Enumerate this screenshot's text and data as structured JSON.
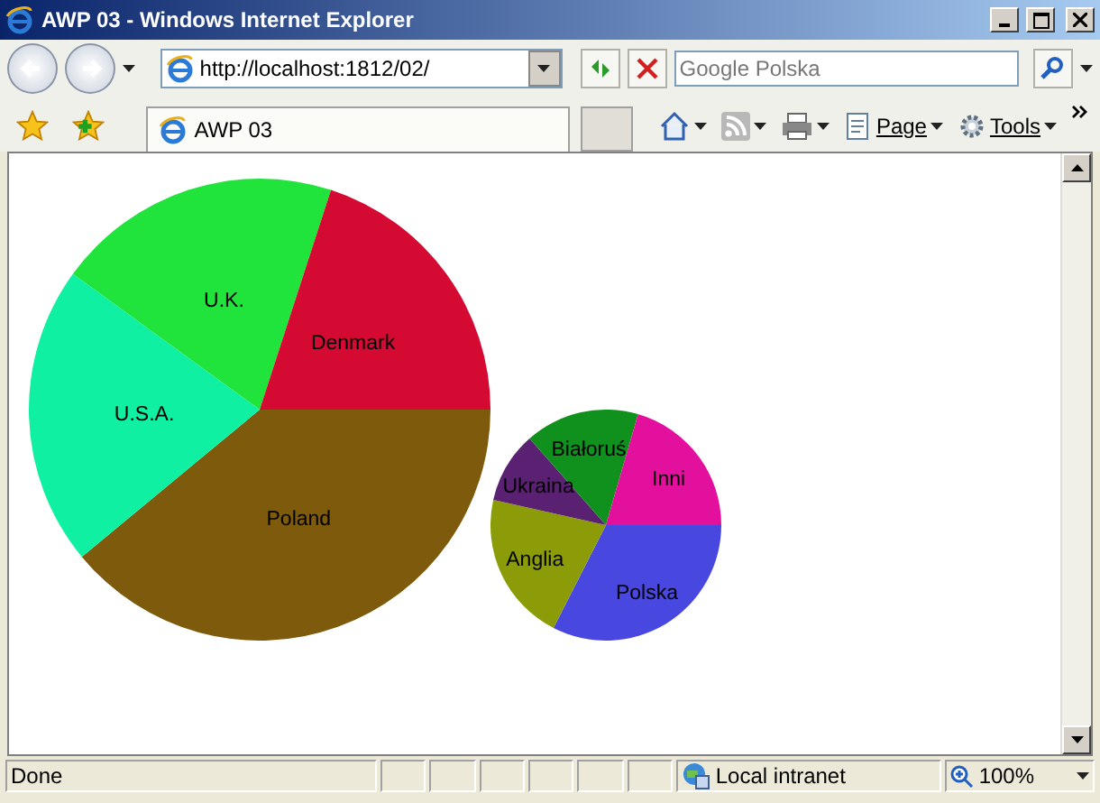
{
  "window": {
    "title": "AWP 03 - Windows Internet Explorer"
  },
  "address_bar": {
    "value": "http://localhost:1812/02/"
  },
  "search": {
    "placeholder": "Google Polska"
  },
  "tab": {
    "label": "AWP 03",
    "selected": true
  },
  "command_bar": [
    {
      "label": "Page"
    },
    {
      "label": "Tools"
    }
  ],
  "charts": [
    {
      "chart_data": {
        "type": "pie",
        "categories": [
          "Poland",
          "U.S.A.",
          "U.K.",
          "Denmark"
        ],
        "values": [
          39,
          21,
          20,
          20
        ],
        "colors": [
          "#7e5a0c",
          "#10f0a2",
          "#20e33c",
          "#d40a32"
        ]
      }
    },
    {
      "chart_data": {
        "type": "pie",
        "categories": [
          "Polska",
          "Anglia",
          "Ukraina",
          "Białoruś",
          "Inni"
        ],
        "values": [
          32.5,
          21,
          10,
          16,
          20.5
        ],
        "colors": [
          "#4848e0",
          "#8c9c08",
          "#5a2072",
          "#10901c",
          "#e2109c"
        ]
      }
    }
  ],
  "status_bar": {
    "text": "Done",
    "zone": "Local intranet",
    "zoom": "100%"
  }
}
